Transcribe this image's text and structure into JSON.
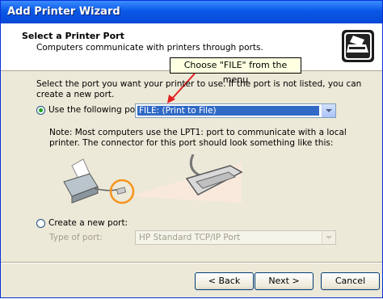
{
  "window": {
    "title": "Add Printer Wizard"
  },
  "header": {
    "title": "Select a Printer Port",
    "subtitle": "Computers communicate with printers through ports.",
    "icon": "printer-icon"
  },
  "callout": {
    "text": "Choose \"FILE\" from the menu"
  },
  "instructions": "Select the port you want your printer to use.  If the port is not listed, you can create a new port.",
  "use_port": {
    "label": "Use the following port:",
    "selected": true,
    "value": "FILE: (Print to File)"
  },
  "note": "Note: Most computers use the LPT1: port to communicate with a local printer. The connector for this port should look something like this:",
  "new_port": {
    "label": "Create a new port:",
    "selected": false,
    "type_label": "Type of port:",
    "type_value": "HP Standard TCP/IP Port"
  },
  "buttons": {
    "back": "< Back",
    "next": "Next >",
    "cancel": "Cancel"
  },
  "colors": {
    "title_bar": "#0a58e6",
    "accent": "#21a121",
    "callout_arrow": "#e02020",
    "highlight_ring": "#f7941d"
  }
}
